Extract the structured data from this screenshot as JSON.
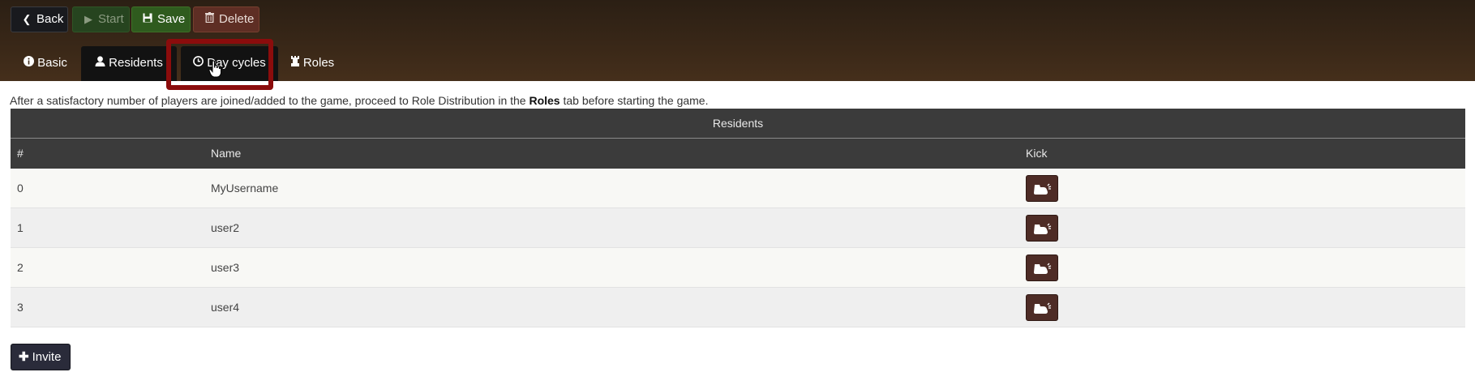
{
  "toolbar": {
    "back_label": "Back",
    "start_label": "Start",
    "save_label": "Save",
    "delete_label": "Delete"
  },
  "tabs": [
    {
      "label": "Basic",
      "icon": "info-icon"
    },
    {
      "label": "Residents",
      "icon": "user-icon"
    },
    {
      "label": "Day cycles",
      "icon": "clock-icon"
    },
    {
      "label": "Roles",
      "icon": "rook-icon"
    }
  ],
  "intro": {
    "before": "After a satisfactory number of players are joined/added to the game, proceed to Role Distribution in the ",
    "bold": "Roles",
    "after": " tab before starting the game."
  },
  "table": {
    "caption": "Residents",
    "columns": [
      "#",
      "Name",
      "Kick"
    ],
    "rows": [
      {
        "num": "0",
        "name": "MyUsername"
      },
      {
        "num": "1",
        "name": "user2"
      },
      {
        "num": "2",
        "name": "user3"
      },
      {
        "num": "3",
        "name": "user4"
      }
    ]
  },
  "invite_label": "Invite",
  "colors": {
    "header_bg": "#3a2818",
    "highlight": "#8b0c0c",
    "kick_button": "#4e2c26",
    "save_button": "#2f5b1e"
  }
}
